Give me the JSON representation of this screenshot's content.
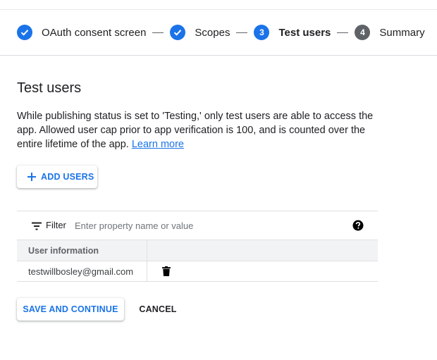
{
  "stepper": {
    "steps": [
      {
        "label": "OAuth consent screen",
        "state": "done",
        "number": ""
      },
      {
        "label": "Scopes",
        "state": "done",
        "number": ""
      },
      {
        "label": "Test users",
        "state": "current",
        "number": "3"
      },
      {
        "label": "Summary",
        "state": "future",
        "number": "4"
      }
    ]
  },
  "page": {
    "title": "Test users",
    "description": "While publishing status is set to 'Testing,' only test users are able to access the app. Allowed user cap prior to app verification is 100, and is counted over the entire lifetime of the app.",
    "learn_more": "Learn more"
  },
  "add_users_label": "ADD USERS",
  "filter": {
    "label": "Filter",
    "placeholder": "Enter property name or value"
  },
  "table": {
    "header": "User information",
    "rows": [
      {
        "user": "testwillbosley@gmail.com"
      }
    ]
  },
  "actions": {
    "save_label": "SAVE AND CONTINUE",
    "cancel_label": "CANCEL"
  },
  "colors": {
    "accent": "#1a73e8",
    "future_step": "#5f6368"
  }
}
